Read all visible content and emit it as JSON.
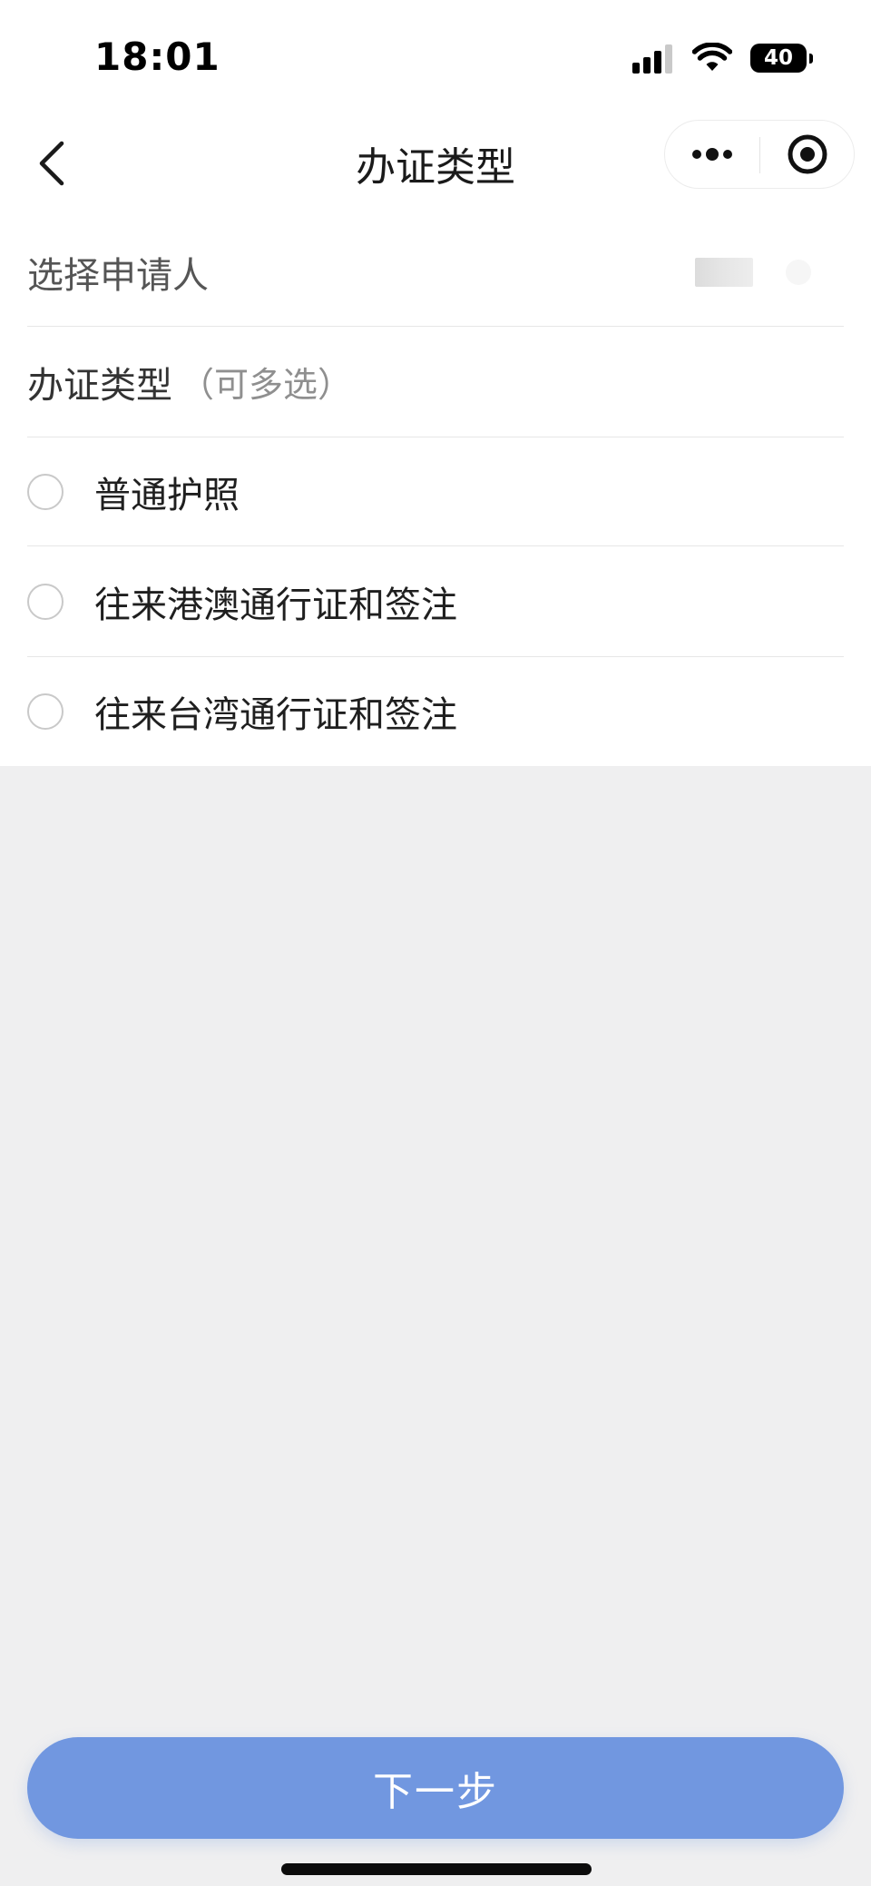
{
  "status_bar": {
    "time": "18:01",
    "battery_level": "40",
    "icons": [
      "signal-icon",
      "wifi-icon",
      "battery-icon"
    ]
  },
  "nav": {
    "title": "办证类型",
    "back_icon": "chevron-left-icon",
    "more_icon": "more-dots-icon",
    "close_icon": "target-circle-icon"
  },
  "applicant": {
    "label": "选择申请人"
  },
  "cert_type": {
    "title": "办证类型",
    "hint": "（可多选）",
    "options": [
      {
        "label": "普通护照",
        "checked": false
      },
      {
        "label": "往来港澳通行证和签注",
        "checked": false
      },
      {
        "label": "往来台湾通行证和签注",
        "checked": false
      }
    ]
  },
  "footer": {
    "next_label": "下一步"
  },
  "colors": {
    "primary_button": "#7197e0",
    "page_background": "#efeff0",
    "card_background": "#ffffff",
    "radio_border": "#c9c9c9"
  }
}
